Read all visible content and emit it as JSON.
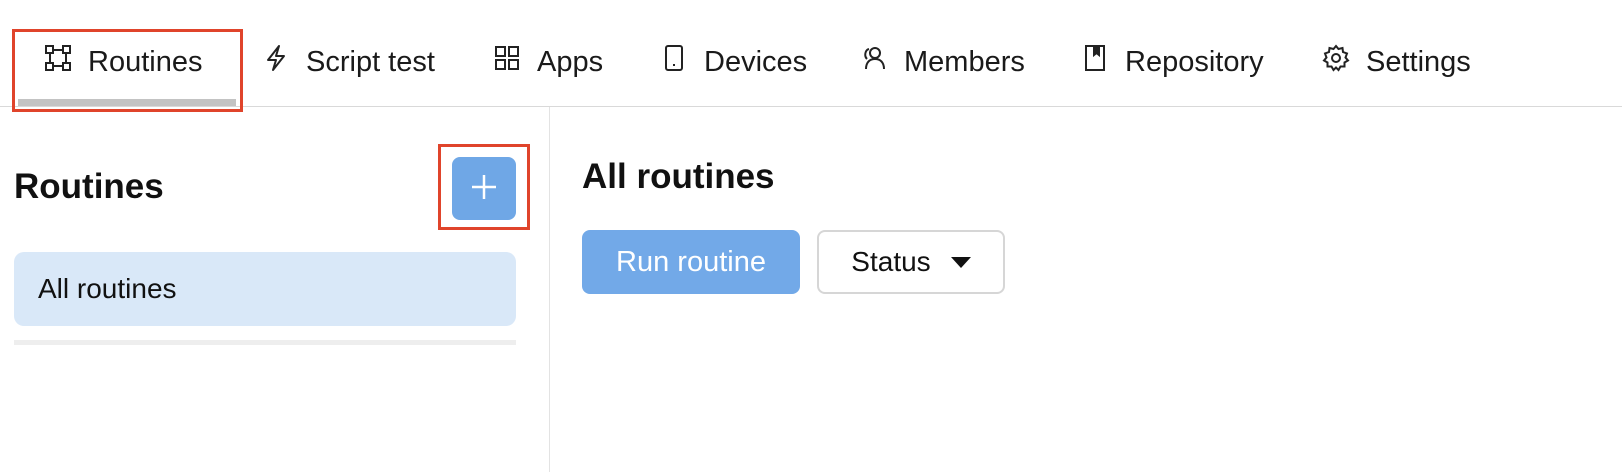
{
  "nav": {
    "tabs": [
      {
        "label": "Routines",
        "icon": "routines-icon",
        "active": true
      },
      {
        "label": "Script test",
        "icon": "lightning-icon"
      },
      {
        "label": "Apps",
        "icon": "grid-icon"
      },
      {
        "label": "Devices",
        "icon": "device-icon"
      },
      {
        "label": "Members",
        "icon": "members-icon"
      },
      {
        "label": "Repository",
        "icon": "book-icon"
      },
      {
        "label": "Settings",
        "icon": "gear-icon"
      }
    ]
  },
  "sidebar": {
    "title": "Routines",
    "add_icon": "plus-icon",
    "items": [
      {
        "label": "All routines",
        "selected": true
      }
    ]
  },
  "main": {
    "title": "All routines",
    "run_button_label": "Run routine",
    "status_filter_label": "Status"
  },
  "colors": {
    "accent": "#6fa7e6",
    "selected_bg": "#d9e8f8",
    "highlight": "#e0442b"
  }
}
